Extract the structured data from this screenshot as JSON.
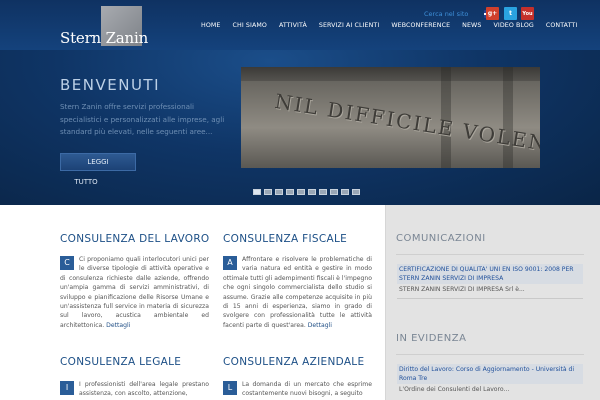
{
  "header": {
    "logo_text": "Stern Zanin",
    "search_link": "Cerca nel sito",
    "nav": [
      "HOME",
      "CHI SIAMO",
      "ATTIVITÀ",
      "SERVIZI AI CLIENTI",
      "WEBCONFERENCE",
      "NEWS",
      "VIDEO BLOG",
      "CONTATTI"
    ],
    "social": {
      "gplus_label": "g+",
      "twitter_label": "t",
      "youtube_label": "You"
    }
  },
  "hero": {
    "title": "BENVENUTI",
    "text": "Stern Zanin offre servizi professionali specialistici e personalizzati alle imprese, agli standard più elevati, nelle seguenti aree...",
    "btn_leggi": "LEGGI",
    "btn_tutto": "TUTTO",
    "slide_inscription": "NIL DIFFICILE VOLENTI",
    "slide_count": 10,
    "active_slide": 1
  },
  "sections": [
    {
      "title": "CONSULENZA DEL LAVORO",
      "initial": "C",
      "text": "Ci proponiamo quali interlocutori unici per le diverse tipologie di attività operative e di consulenza richieste dalle aziende, offrendo un'ampia gamma di servizi amministrativi, di sviluppo e pianificazione delle Risorse Umane e un'assistenza full service in materia di sicurezza sul lavoro, acustica ambientale ed architettonica.",
      "more": "Dettagli"
    },
    {
      "title": "CONSULENZA FISCALE",
      "initial": "A",
      "text": "Affrontare e risolvere le problematiche di varia natura ed entità e gestire in modo ottimale tutti gli adempimenti fiscali è l'impegno che ogni singolo commercialista dello studio si assume. Grazie alle competenze acquisite in più di 15 anni di esperienza, siamo in grado di svolgere con professionalità tutte le attività facenti parte di quest'area.",
      "more": "Dettagli"
    },
    {
      "title": "CONSULENZA LEGALE",
      "initial": "I",
      "text": "I professionisti dell'area legale prestano assistenza, con ascolto, attenzione,",
      "more": ""
    },
    {
      "title": "CONSULENZA AZIENDALE",
      "initial": "L",
      "text": "La domanda di un mercato che esprime costantemente nuovi bisogni, a seguito",
      "more": ""
    }
  ],
  "sidebar": {
    "comunicazioni_title": "COMUNICAZIONI",
    "comunicazioni": [
      {
        "headline": "CERTIFICAZIONE DI QUALITA' UNI EN ISO 9001: 2008 PER STERN ZANIN SERVIZI DI IMPRESA",
        "sub": "STERN ZANIN SERVIZI DI IMPRESA Srl è..."
      }
    ],
    "evidenza_title": "IN EVIDENZA",
    "evidenza": [
      {
        "headline": "Diritto del Lavoro: Corso di Aggiornamento - Università di Roma Tre",
        "sub": "L'Ordine dei Consulenti del Lavoro..."
      }
    ]
  },
  "colors": {
    "brand_blue": "#1c4f86",
    "link_blue": "#1f4f9a",
    "hero_dark": "#0a2547"
  }
}
